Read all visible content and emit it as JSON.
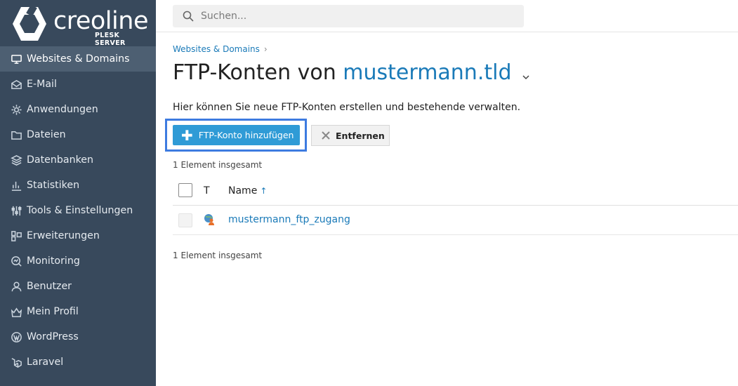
{
  "brand": {
    "name": "creoline",
    "sub": "PLESK SERVER"
  },
  "sidebar": {
    "items": [
      {
        "label": "Websites & Domains",
        "icon": "monitor-icon",
        "active": true
      },
      {
        "label": "E-Mail",
        "icon": "mail-icon"
      },
      {
        "label": "Anwendungen",
        "icon": "gear-icon"
      },
      {
        "label": "Dateien",
        "icon": "folder-icon"
      },
      {
        "label": "Datenbanken",
        "icon": "database-icon"
      },
      {
        "label": "Statistiken",
        "icon": "bar-chart-icon"
      },
      {
        "label": "Tools & Einstellungen",
        "icon": "sliders-icon"
      },
      {
        "label": "Erweiterungen",
        "icon": "extensions-icon"
      },
      {
        "label": "Monitoring",
        "icon": "monitoring-icon"
      },
      {
        "label": "Benutzer",
        "icon": "user-icon"
      },
      {
        "label": "Mein Profil",
        "icon": "profile-icon"
      },
      {
        "label": "WordPress",
        "icon": "wordpress-icon"
      },
      {
        "label": "Laravel",
        "icon": "laravel-icon"
      }
    ]
  },
  "search": {
    "placeholder": "Suchen..."
  },
  "breadcrumb": {
    "item": "Websites & Domains",
    "separator": "›"
  },
  "page": {
    "title_prefix": "FTP-Konten von",
    "title_domain": "mustermann.tld",
    "description": "Hier können Sie neue FTP-Konten erstellen und bestehende verwalten."
  },
  "toolbar": {
    "add_label": "FTP-Konto hinzufügen",
    "remove_label": "Entfernen"
  },
  "table": {
    "count_top": "1 Element insgesamt",
    "count_bottom": "1 Element insgesamt",
    "headers": {
      "type": "T",
      "name": "Name",
      "sort_arrow": "↑"
    },
    "rows": [
      {
        "name": "mustermann_ftp_zugang"
      }
    ]
  },
  "colors": {
    "sidebar": "#38495c",
    "accent": "#1a7ab8",
    "button": "#2f9bd6",
    "highlight": "#3d7be0"
  }
}
